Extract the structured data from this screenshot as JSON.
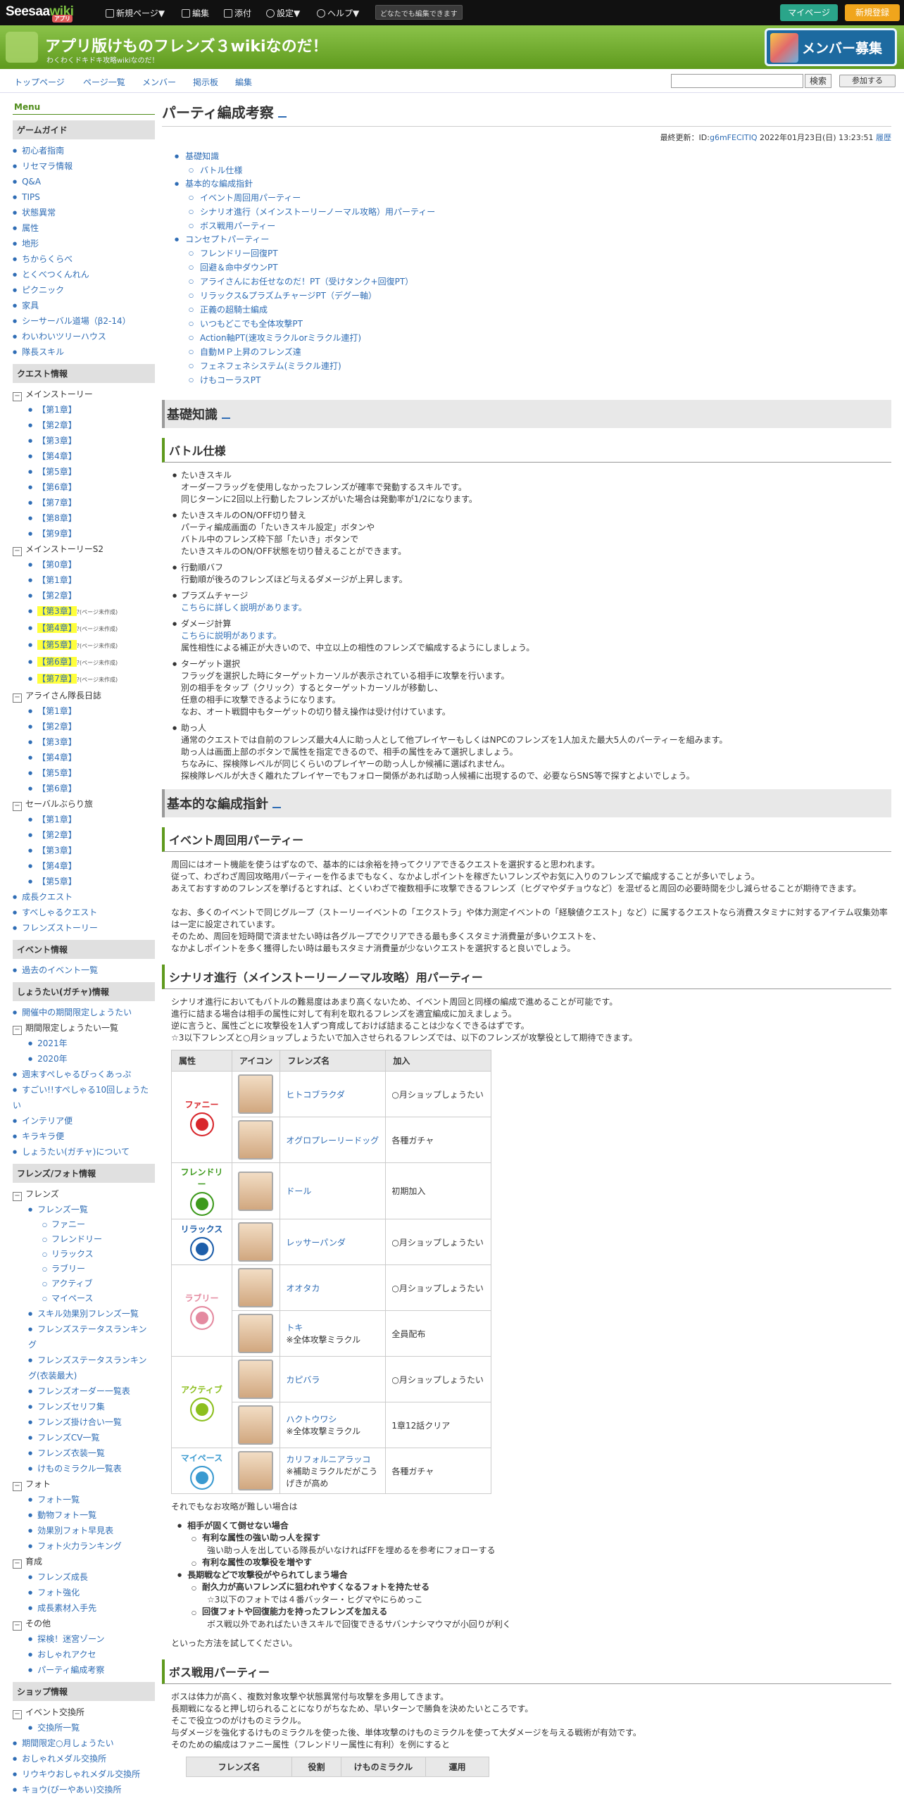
{
  "topbar": {
    "logo": "Seesaa",
    "logo_wiki": "wiki",
    "logo_badge": "アプリ",
    "items": [
      "新規ページ▼",
      "編集",
      "添付",
      "設定▼",
      "ヘルプ▼"
    ],
    "editable": "どなたでも編集できます",
    "mypage": "マイページ",
    "signup": "新規登録"
  },
  "header": {
    "title": "アプリ版けものフレンズ３wikiなのだ！",
    "subtitle": "わくわくドキドキ攻略wikiなのだ！",
    "banner": "メンバー募集"
  },
  "nav": {
    "items": [
      "トップページ",
      "ページ一覧",
      "メンバー",
      "掲示板",
      "編集"
    ],
    "search_button": "検索",
    "join_button": "参加する"
  },
  "sidebar": {
    "menu": "Menu",
    "sections": [
      {
        "title": "ゲームガイド",
        "items": [
          {
            "t": "初心者指南",
            "k": "b"
          },
          {
            "t": "リセマラ情報",
            "k": "b"
          },
          {
            "t": "Q&A",
            "k": "b"
          },
          {
            "t": "TIPS",
            "k": "b"
          },
          {
            "t": "状態異常",
            "k": "b"
          },
          {
            "t": "属性",
            "k": "b"
          },
          {
            "t": "地形",
            "k": "b"
          },
          {
            "t": "ちからくらべ",
            "k": "b"
          },
          {
            "t": "とくべつくんれん",
            "k": "b"
          },
          {
            "t": "ピクニック",
            "k": "b"
          },
          {
            "t": "家具",
            "k": "b"
          },
          {
            "t": "シーサーバル道場（β2-14）",
            "k": "b"
          },
          {
            "t": "わいわいツリーハウス",
            "k": "b"
          },
          {
            "t": "隊長スキル",
            "k": "b"
          }
        ]
      },
      {
        "title": "クエスト情報",
        "items": [
          {
            "t": "メインストーリー",
            "k": "g"
          },
          {
            "t": "【第1章】",
            "k": "c"
          },
          {
            "t": "【第2章】",
            "k": "c"
          },
          {
            "t": "【第3章】",
            "k": "c"
          },
          {
            "t": "【第4章】",
            "k": "c"
          },
          {
            "t": "【第5章】",
            "k": "c"
          },
          {
            "t": "【第6章】",
            "k": "c"
          },
          {
            "t": "【第7章】",
            "k": "c"
          },
          {
            "t": "【第8章】",
            "k": "c"
          },
          {
            "t": "【第9章】",
            "k": "c"
          },
          {
            "t": "メインストーリーS2",
            "k": "g"
          },
          {
            "t": "【第0章】",
            "k": "c"
          },
          {
            "t": "【第1章】",
            "k": "c"
          },
          {
            "t": "【第2章】",
            "k": "c"
          },
          {
            "t": "【第3章】",
            "k": "c",
            "h": "?(ページ未作成)"
          },
          {
            "t": "【第4章】",
            "k": "c",
            "h": "?(ページ未作成)"
          },
          {
            "t": "【第5章】",
            "k": "c",
            "h": "?(ページ未作成)"
          },
          {
            "t": "【第6章】",
            "k": "c",
            "h": "?(ページ未作成)"
          },
          {
            "t": "【第7章】",
            "k": "c",
            "h": "?(ページ未作成)"
          },
          {
            "t": "アライさん隊長日誌",
            "k": "g"
          },
          {
            "t": "【第1章】",
            "k": "c"
          },
          {
            "t": "【第2章】",
            "k": "c"
          },
          {
            "t": "【第3章】",
            "k": "c"
          },
          {
            "t": "【第4章】",
            "k": "c"
          },
          {
            "t": "【第5章】",
            "k": "c"
          },
          {
            "t": "【第6章】",
            "k": "c"
          },
          {
            "t": "セーバルぶらり旅",
            "k": "g"
          },
          {
            "t": "【第1章】",
            "k": "c"
          },
          {
            "t": "【第2章】",
            "k": "c"
          },
          {
            "t": "【第3章】",
            "k": "c"
          },
          {
            "t": "【第4章】",
            "k": "c"
          },
          {
            "t": "【第5章】",
            "k": "c"
          },
          {
            "t": "成長クエスト",
            "k": "b"
          },
          {
            "t": "すべしゃるクエスト",
            "k": "b"
          },
          {
            "t": "フレンズストーリー",
            "k": "b"
          }
        ]
      },
      {
        "title": "イベント情報",
        "items": [
          {
            "t": "過去のイベント一覧",
            "k": "b"
          }
        ]
      },
      {
        "title": "しょうたい(ガチャ)情報",
        "items": [
          {
            "t": "開催中の期間限定しょうたい",
            "k": "b"
          },
          {
            "t": "期間限定しょうたい一覧",
            "k": "g"
          },
          {
            "t": "2021年",
            "k": "c"
          },
          {
            "t": "2020年",
            "k": "c"
          },
          {
            "t": "週末すぺしゃるぴっくあっぷ",
            "k": "b"
          },
          {
            "t": "すごい!!すぺしゃる10回しょうたい",
            "k": "b"
          },
          {
            "t": "インテリア便",
            "k": "b"
          },
          {
            "t": "キラキラ便",
            "k": "b"
          },
          {
            "t": "しょうたい(ガチャ)について",
            "k": "b"
          }
        ]
      },
      {
        "title": "フレンズ/フォト情報",
        "items": [
          {
            "t": "フレンズ",
            "k": "g"
          },
          {
            "t": "フレンズ一覧",
            "k": "c"
          },
          {
            "t": "ファニー",
            "k": "d"
          },
          {
            "t": "フレンドリー",
            "k": "d"
          },
          {
            "t": "リラックス",
            "k": "d"
          },
          {
            "t": "ラブリー",
            "k": "d"
          },
          {
            "t": "アクティブ",
            "k": "d"
          },
          {
            "t": "マイペース",
            "k": "d"
          },
          {
            "t": "スキル効果別フレンズ一覧",
            "k": "c"
          },
          {
            "t": "フレンズステータスランキング",
            "k": "c"
          },
          {
            "t": "フレンズステータスランキング(衣装最大)",
            "k": "c"
          },
          {
            "t": "フレンズオーダー一覧表",
            "k": "c"
          },
          {
            "t": "フレンズセリフ集",
            "k": "c"
          },
          {
            "t": "フレンズ掛け合い一覧",
            "k": "c"
          },
          {
            "t": "フレンズCV一覧",
            "k": "c"
          },
          {
            "t": "フレンズ衣装一覧",
            "k": "c"
          },
          {
            "t": "けものミラクル一覧表",
            "k": "c"
          },
          {
            "t": "フォト",
            "k": "g"
          },
          {
            "t": "フォト一覧",
            "k": "c"
          },
          {
            "t": "動物フォト一覧",
            "k": "c"
          },
          {
            "t": "効果別フォト早見表",
            "k": "c"
          },
          {
            "t": "フォト火力ランキング",
            "k": "c"
          },
          {
            "t": "育成",
            "k": "g"
          },
          {
            "t": "フレンズ成長",
            "k": "c"
          },
          {
            "t": "フォト強化",
            "k": "c"
          },
          {
            "t": "成長素材入手先",
            "k": "c"
          },
          {
            "t": "その他",
            "k": "g"
          },
          {
            "t": "探検！迷宮ゾーン",
            "k": "c"
          },
          {
            "t": "おしゃれアクセ",
            "k": "c"
          },
          {
            "t": "パーティ編成考察",
            "k": "c"
          }
        ]
      },
      {
        "title": "ショップ情報",
        "items": [
          {
            "t": "イベント交換所",
            "k": "g"
          },
          {
            "t": "交換所一覧",
            "k": "c"
          },
          {
            "t": "期間限定○月しょうたい",
            "k": "b"
          },
          {
            "t": "おしゃれメダル交換所",
            "k": "b"
          },
          {
            "t": "リウキウおしゃれメダル交換所",
            "k": "b"
          },
          {
            "t": "キョウ(ぴーやあい)交換所",
            "k": "b"
          }
        ]
      }
    ]
  },
  "page": {
    "title": "パーティ編成考察",
    "updated_label": "最終更新：ID:",
    "updated_id": "g6mFECITIQ",
    "updated_date": "2022年01月23日(日) 13:23:51",
    "history": "履歴"
  },
  "toc": [
    {
      "t": "基礎知識",
      "s": 0
    },
    {
      "t": "バトル仕様",
      "s": 1
    },
    {
      "t": "基本的な編成指針",
      "s": 0
    },
    {
      "t": "イベント周回用パーティー",
      "s": 1
    },
    {
      "t": "シナリオ進行（メインストーリーノーマル攻略）用パーティー",
      "s": 1
    },
    {
      "t": "ボス戦用パーティー",
      "s": 1
    },
    {
      "t": "コンセプトパーティー",
      "s": 0
    },
    {
      "t": "フレンドリー回復PT",
      "s": 1
    },
    {
      "t": "回避＆命中ダウンPT",
      "s": 1
    },
    {
      "t": "アライさんにお任せなのだ！PT（受けタンク+回復PT）",
      "s": 1
    },
    {
      "t": "リラックス&プラズムチャージPT（デグー軸）",
      "s": 1
    },
    {
      "t": "正義の超騎士編成",
      "s": 1
    },
    {
      "t": "いつもどこでも全体攻撃PT",
      "s": 1
    },
    {
      "t": "Action軸PT(速攻ミラクルorミラクル連打)",
      "s": 1
    },
    {
      "t": "自動ＭＰ上昇のフレンズ達",
      "s": 1
    },
    {
      "t": "フェネフェネシステム(ミラクル連打)",
      "s": 1
    },
    {
      "t": "けもコーラスPT",
      "s": 1
    }
  ],
  "sec1": {
    "h2": "基礎知識",
    "h3": "バトル仕様",
    "items": [
      [
        "たいきスキル",
        "オーダーフラッグを使用しなかったフレンズが確率で発動するスキルです。",
        "同じターンに2回以上行動したフレンズがいた場合は発動率が1/2になります。"
      ],
      [
        "たいきスキルのON/OFF切り替え",
        "パーティ編成画面の「たいきスキル設定」ボタンや",
        "バトル中のフレンズ枠下部「たいき」ボタンで",
        "たいきスキルのON/OFF状態を切り替えることができます。"
      ],
      [
        "行動順バフ",
        "行動順が後ろのフレンズほど与えるダメージが上昇します。"
      ],
      [
        "プラズムチャージ",
        "こちらに詳しく説明があります。"
      ],
      [
        "ダメージ計算",
        "こちらに説明があります。",
        "属性相性による補正が大きいので、中立以上の相性のフレンズで編成するようにしましょう。"
      ],
      [
        "ターゲット選択",
        "フラッグを選択した時にターゲットカーソルが表示されている相手に攻撃を行います。",
        "別の相手をタップ（クリック）するとターゲットカーソルが移動し、",
        "任意の相手に攻撃できるようになります。",
        "なお、オート戦闘中もターゲットの切り替え操作は受け付けています。"
      ],
      [
        "助っ人",
        "通常のクエストでは自前のフレンズ最大4人に助っ人として他プレイヤーもしくはNPCのフレンズを1人加えた最大5人のパーティーを組みます。",
        "助っ人は画面上部のボタンで属性を指定できるので、相手の属性をみて選択しましょう。",
        "ちなみに、探検隊レベルが同じくらいのプレイヤーの助っ人しか候補に選ばれません。",
        "探検隊レベルが大きく離れたプレイヤーでもフォロー関係があれば助っ人候補に出現するので、必要ならSNS等で探すとよいでしょう。"
      ]
    ]
  },
  "sec2": {
    "h2": "基本的な編成指針",
    "event": {
      "h3": "イベント周回用パーティー",
      "lines": [
        "周回にはオート機能を使うはずなので、基本的には余裕を持ってクリアできるクエストを選択すると思われます。",
        "従って、わざわざ周回攻略用パーティーを作るまでもなく、なかよしポイントを稼ぎたいフレンズやお気に入りのフレンズで編成することが多いでしょう。",
        "あえておすすめのフレンズを挙げるとすれば、とくいわざで複数相手に攻撃できるフレンズ（ヒグマやダチョウなど）を混ぜると周回の必要時間を少し減らせることが期待できます。",
        "",
        "なお、多くのイベントで同じグループ（ストーリーイベントの「エクストラ」や体力測定イベントの「経験値クエスト」など）に属するクエストなら消費スタミナに対するアイテム収集効率は一定に設定されています。",
        "そのため、周回を短時間で済ませたい時は各グループでクリアできる最も多くスタミナ消費量が多いクエストを、",
        "なかよしポイントを多く獲得したい時は最もスタミナ消費量が少ないクエストを選択すると良いでしょう。"
      ]
    },
    "scenario": {
      "h3": "シナリオ進行（メインストーリーノーマル攻略）用パーティー",
      "lines": [
        "シナリオ進行においてもバトルの難易度はあまり高くないため、イベント周回と同様の編成で進めることが可能です。",
        "進行に詰まる場合は相手の属性に対して有利を取れるフレンズを適宜編成に加えましょう。",
        "逆に言うと、属性ごとに攻撃役を1人ずつ育成しておけば詰まることは少なくできるはずです。",
        "☆3以下フレンズと○月ショップしょうたいで加入させられるフレンズでは、以下のフレンズが攻撃役として期待できます。"
      ],
      "table_headers": [
        "属性",
        "アイコン",
        "フレンズ名",
        "加入"
      ],
      "groups": [
        {
          "attr": "ファニー",
          "color": "#d8262b",
          "rows": [
            {
              "name": "ヒトコブラクダ",
              "note": "",
              "join": "○月ショップしょうたい"
            },
            {
              "name": "オグロプレーリードッグ",
              "note": "",
              "join": "各種ガチャ"
            }
          ]
        },
        {
          "attr": "フレンドリー",
          "color": "#3e9a1d",
          "rows": [
            {
              "name": "ドール",
              "note": "",
              "join": "初期加入"
            }
          ]
        },
        {
          "attr": "リラックス",
          "color": "#1d5eaa",
          "rows": [
            {
              "name": "レッサーパンダ",
              "note": "",
              "join": "○月ショップしょうたい"
            }
          ]
        },
        {
          "attr": "ラブリー",
          "color": "#e48aa0",
          "rows": [
            {
              "name": "オオタカ",
              "note": "",
              "join": "○月ショップしょうたい"
            },
            {
              "name": "トキ",
              "note": "※全体攻撃ミラクル",
              "join": "全員配布"
            }
          ]
        },
        {
          "attr": "アクティブ",
          "color": "#8cbf1e",
          "rows": [
            {
              "name": "カピバラ",
              "note": "",
              "join": "○月ショップしょうたい"
            },
            {
              "name": "ハクトウワシ",
              "note": "※全体攻撃ミラクル",
              "join": "1章12話クリア"
            }
          ]
        },
        {
          "attr": "マイペース",
          "color": "#3a9ad0",
          "rows": [
            {
              "name": "カリフォルニアラッコ",
              "note": "※補助ミラクルだがこうげきが高め",
              "join": "各種ガチャ"
            }
          ]
        }
      ],
      "after_intro": "それでもなお攻略が難しい場合は",
      "tips": [
        {
          "k": "b1",
          "t": "相手が固くて倒せない場合",
          "bold": true
        },
        {
          "k": "b2",
          "t": "有利な属性の強い助っ人を探す",
          "bold": true
        },
        {
          "k": "t3",
          "t": "強い助っ人を出している隊長がいなければFFを埋めるを参考にフォローする"
        },
        {
          "k": "b2",
          "t": "有利な属性の攻撃役を増やす",
          "bold": true
        },
        {
          "k": "b1",
          "t": "長期戦などで攻撃役がやられてしまう場合",
          "bold": true
        },
        {
          "k": "b2",
          "t": "耐久力が高いフレンズに狙われやすくなるフォトを持たせる",
          "bold": true
        },
        {
          "k": "t3",
          "t": "☆3以下のフォトでは４番バッター・ヒグマやにらめっこ"
        },
        {
          "k": "b2",
          "t": "回復フォトや回復能力を持ったフレンズを加える",
          "bold": true
        },
        {
          "k": "t3",
          "t": "ボス戦以外であればたいきスキルで回復できるサバンナシマウマが小回りが利く"
        }
      ],
      "closing": "といった方法を試してください。"
    },
    "boss": {
      "h3": "ボス戦用パーティー",
      "lines": [
        "ボスは体力が高く、複数対象攻撃や状態異常付与攻撃を多用してきます。",
        "長期戦になると押し切られることになりがちなため、早いターンで勝負を決めたいところです。",
        "そこで役立つのがけものミラクル。",
        "与ダメージを強化するけものミラクルを使った後、単体攻撃のけものミラクルを使って大ダメージを与える戦術が有効です。",
        "そのための編成はファニー属性（フレンドリー属性に有利）を例にすると"
      ],
      "table_headers": [
        "フレンズ名",
        "役割",
        "けものミラクル",
        "運用"
      ]
    }
  }
}
